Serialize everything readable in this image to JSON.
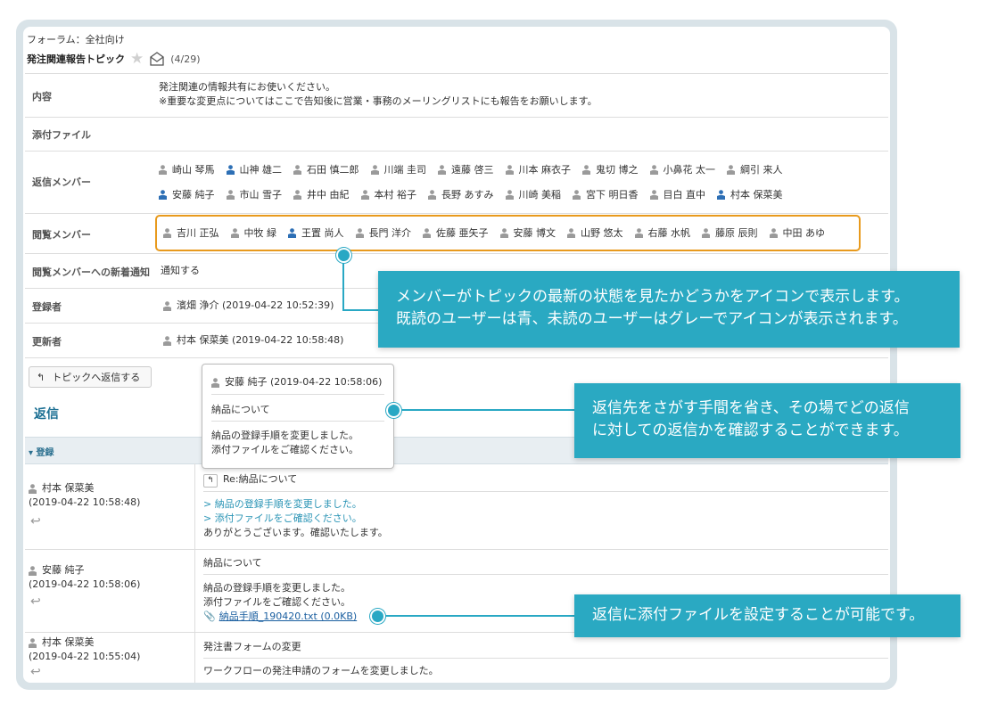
{
  "header": {
    "forum": "フォーラム：全社向け",
    "topic_title": "発注関連報告トピック",
    "count": "(4/29)"
  },
  "fields": {
    "content_label": "内容",
    "content_line1": "発注関連の情報共有にお使いください。",
    "content_line2": "※重要な変更点についてはここで告知後に営業・事務のメーリングリストにも報告をお願いします。",
    "attach_label": "添付ファイル",
    "reply_members_label": "返信メンバー",
    "viewer_members_label": "閲覧メンバー",
    "notify_label": "閲覧メンバーへの新着通知",
    "notify_value": "通知する",
    "registered_label": "登録者",
    "registered_value": "濱畑 浄介 (2019-04-22 10:52:39)",
    "updated_label": "更新者",
    "updated_value": "村本 保菜美 (2019-04-22 10:58:48)"
  },
  "reply_members_row1": [
    {
      "name": "崎山 琴馬",
      "read": false
    },
    {
      "name": "山神 雄二",
      "read": true
    },
    {
      "name": "石田 慎二郎",
      "read": false
    },
    {
      "name": "川端 圭司",
      "read": false
    },
    {
      "name": "遠藤 啓三",
      "read": false
    },
    {
      "name": "川本 麻衣子",
      "read": false
    },
    {
      "name": "鬼切 博之",
      "read": false
    },
    {
      "name": "小鼻花 太一",
      "read": false
    },
    {
      "name": "綱引 来人",
      "read": false
    }
  ],
  "reply_members_row2": [
    {
      "name": "安藤 純子",
      "read": true
    },
    {
      "name": "市山 雪子",
      "read": false
    },
    {
      "name": "井中 由紀",
      "read": false
    },
    {
      "name": "本村 裕子",
      "read": false
    },
    {
      "name": "長野 あすみ",
      "read": false
    },
    {
      "name": "川崎 美稲",
      "read": false
    },
    {
      "name": "宮下 明日香",
      "read": false
    },
    {
      "name": "目白 直中",
      "read": false
    },
    {
      "name": "村本 保菜美",
      "read": true
    }
  ],
  "viewer_members": [
    {
      "name": "吉川 正弘",
      "read": false
    },
    {
      "name": "中牧 緑",
      "read": false
    },
    {
      "name": "王置 尚人",
      "read": true
    },
    {
      "name": "長門 洋介",
      "read": false
    },
    {
      "name": "佐藤 亜矢子",
      "read": false
    },
    {
      "name": "安藤 博文",
      "read": false
    },
    {
      "name": "山野 悠太",
      "read": false
    },
    {
      "name": "右藤 水帆",
      "read": false
    },
    {
      "name": "藤原 辰則",
      "read": false
    },
    {
      "name": "中田 あゆ",
      "read": false
    }
  ],
  "reply_button": "トピックへ返信する",
  "reply_heading": "返信",
  "section_label": "▾ 登録",
  "tooltip": {
    "author": "安藤 純子 (2019-04-22 10:58:06)",
    "subject": "納品について",
    "body1": "納品の登録手順を変更しました。",
    "body2": "添付ファイルをご確認ください。"
  },
  "posts": [
    {
      "author": "村本 保菜美",
      "time": "(2019-04-22 10:58:48)",
      "subject": "Re:納品について",
      "quote1": "> 納品の登録手順を変更しました。",
      "quote2": "> 添付ファイルをご確認ください。",
      "body": "ありがとうございます。確認いたします。"
    },
    {
      "author": "安藤 純子",
      "time": "(2019-04-22 10:58:06)",
      "subject": "納品について",
      "body1": "納品の登録手順を変更しました。",
      "body2": "添付ファイルをご確認ください。",
      "attachment": "納品手順_190420.txt (0.0KB)"
    },
    {
      "author": "村本 保菜美",
      "time": "(2019-04-22 10:55:04)",
      "subject": "発注書フォームの変更",
      "body": "ワークフローの発注申請のフォームを変更しました。"
    }
  ],
  "callouts": {
    "c1_line1": "メンバーがトピックの最新の状態を見たかどうかをアイコンで表示します。",
    "c1_line2": "既読のユーザーは青、未読のユーザーはグレーでアイコンが表示されます。",
    "c2_line1": "返信先をさがす手間を省き、その場でどの返信",
    "c2_line2": "に対しての返信かを確認することができます。",
    "c3": "返信に添付ファイルを設定することが可能です。"
  },
  "colors": {
    "read": "#2d6fb5",
    "unread": "#9a9a9a",
    "accent": "#2aa9c2",
    "highlight": "#e89a1d"
  }
}
